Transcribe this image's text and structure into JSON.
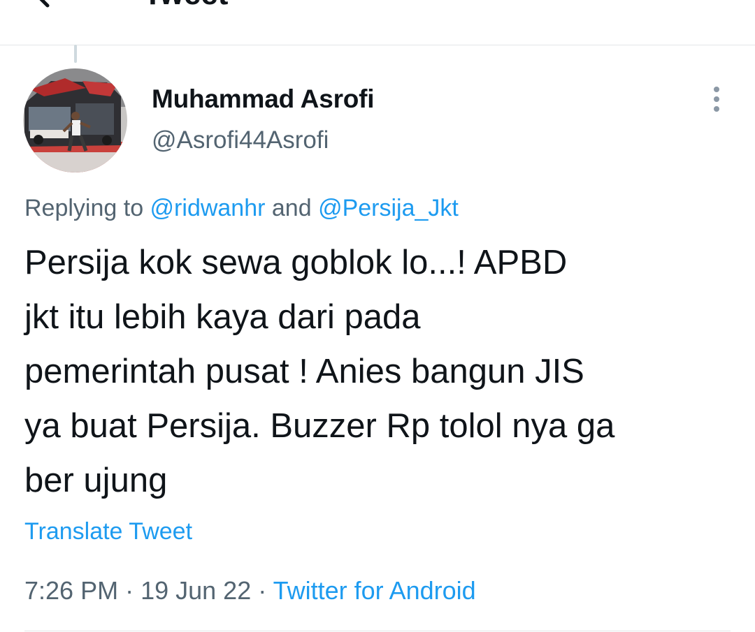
{
  "header": {
    "title": "Tweet",
    "back_icon": "arrow-left-icon"
  },
  "tweet": {
    "author": {
      "display_name": "Muhammad Asrofi",
      "handle": "@Asrofi44Asrofi"
    },
    "reply": {
      "prefix": "Replying to ",
      "mention_1": "@ridwanhr",
      "conjunction": " and ",
      "mention_2": "@Persija_Jkt"
    },
    "text": "Persija kok sewa goblok  lo...! APBD\njkt itu lebih kaya dari pada\npemerintah pusat ! Anies bangun JIS\nya buat Persija. Buzzer Rp tolol nya ga\nber ujung",
    "translate_label": "Translate Tweet",
    "meta": {
      "time": "7:26 PM",
      "separator": " · ",
      "date": "19 Jun 22",
      "source": "Twitter for Android"
    },
    "more_icon": "more-vertical-icon"
  },
  "colors": {
    "text_primary": "#0f1419",
    "text_secondary": "#536471",
    "accent": "#1d9bf0",
    "divider": "#e3e6e8"
  }
}
